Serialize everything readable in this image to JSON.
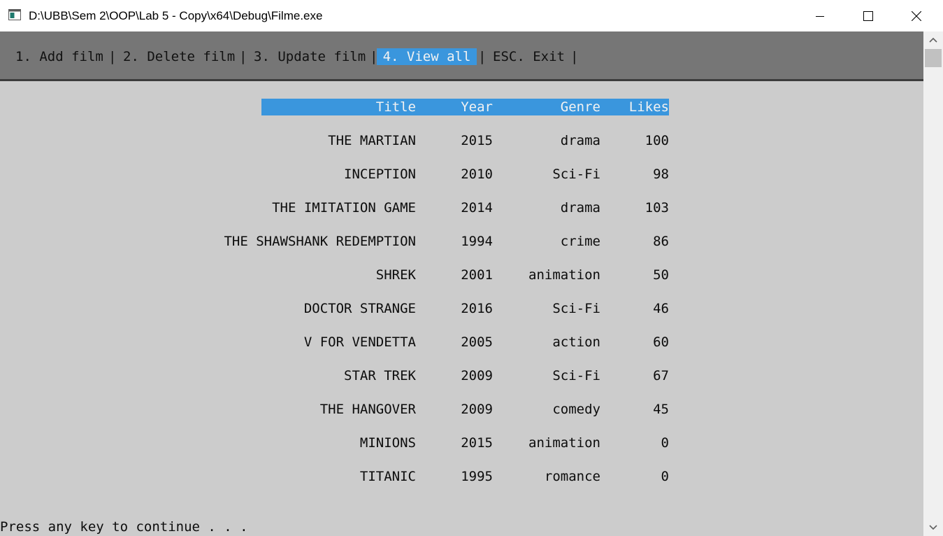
{
  "window": {
    "title": "D:\\UBB\\Sem 2\\OOP\\Lab 5 - Copy\\x64\\Debug\\Filme.exe"
  },
  "menu": {
    "items": [
      {
        "label": "1. Add film"
      },
      {
        "label": "2. Delete film"
      },
      {
        "label": "3. Update film"
      },
      {
        "label": "4. View all",
        "active": true
      },
      {
        "label": "ESC. Exit"
      }
    ],
    "separator": "|"
  },
  "table": {
    "headers": {
      "title": "Title",
      "year": "Year",
      "genre": "Genre",
      "likes": "Likes"
    },
    "rows": [
      {
        "title": "THE MARTIAN",
        "year": "2015",
        "genre": "drama",
        "likes": "100"
      },
      {
        "title": "INCEPTION",
        "year": "2010",
        "genre": "Sci-Fi",
        "likes": "98"
      },
      {
        "title": "THE IMITATION GAME",
        "year": "2014",
        "genre": "drama",
        "likes": "103"
      },
      {
        "title": "THE SHAWSHANK REDEMPTION",
        "year": "1994",
        "genre": "crime",
        "likes": "86"
      },
      {
        "title": "SHREK",
        "year": "2001",
        "genre": "animation",
        "likes": "50"
      },
      {
        "title": "DOCTOR STRANGE",
        "year": "2016",
        "genre": "Sci-Fi",
        "likes": "46"
      },
      {
        "title": "V FOR VENDETTA",
        "year": "2005",
        "genre": "action",
        "likes": "60"
      },
      {
        "title": "STAR TREK",
        "year": "2009",
        "genre": "Sci-Fi",
        "likes": "67"
      },
      {
        "title": "THE HANGOVER",
        "year": "2009",
        "genre": "comedy",
        "likes": "45"
      },
      {
        "title": "MINIONS",
        "year": "2015",
        "genre": "animation",
        "likes": "0"
      },
      {
        "title": "TITANIC",
        "year": "1995",
        "genre": "romance",
        "likes": "0"
      }
    ]
  },
  "prompt": "Press any key to continue . . .",
  "colors": {
    "console_bg": "#cccccc",
    "menu_bg": "#767676",
    "highlight": "#3a96dd",
    "highlight_text": "#f2f2f2"
  }
}
